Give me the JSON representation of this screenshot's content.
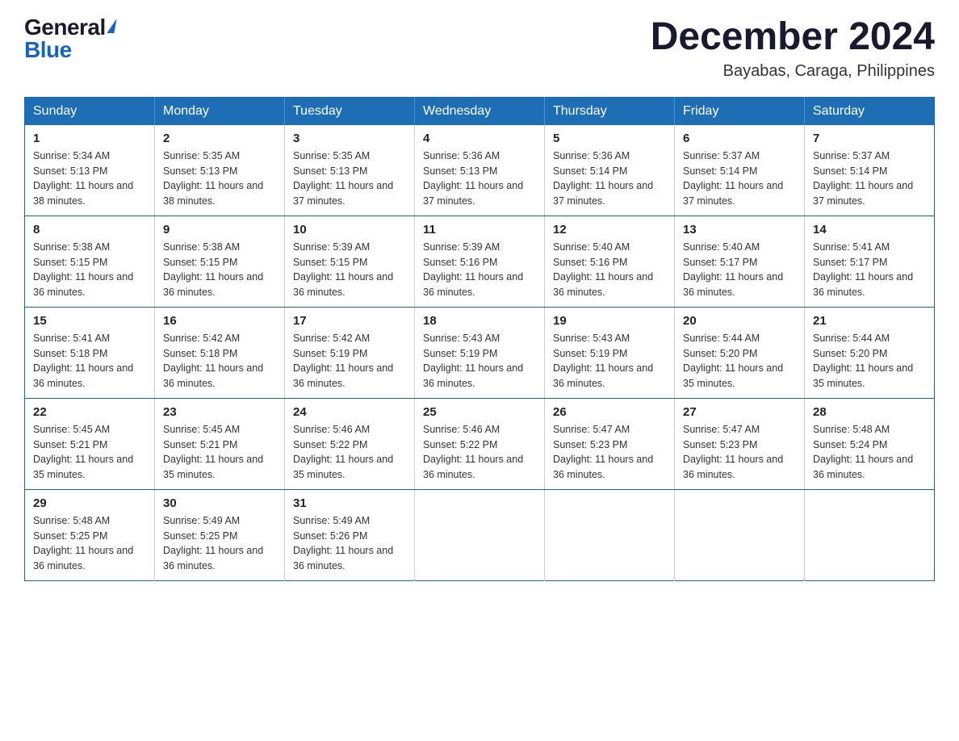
{
  "logo": {
    "general": "General",
    "blue": "Blue"
  },
  "header": {
    "month": "December 2024",
    "location": "Bayabas, Caraga, Philippines"
  },
  "days_of_week": [
    "Sunday",
    "Monday",
    "Tuesday",
    "Wednesday",
    "Thursday",
    "Friday",
    "Saturday"
  ],
  "weeks": [
    [
      {
        "day": "1",
        "sunrise": "5:34 AM",
        "sunset": "5:13 PM",
        "daylight": "11 hours and 38 minutes."
      },
      {
        "day": "2",
        "sunrise": "5:35 AM",
        "sunset": "5:13 PM",
        "daylight": "11 hours and 38 minutes."
      },
      {
        "day": "3",
        "sunrise": "5:35 AM",
        "sunset": "5:13 PM",
        "daylight": "11 hours and 37 minutes."
      },
      {
        "day": "4",
        "sunrise": "5:36 AM",
        "sunset": "5:13 PM",
        "daylight": "11 hours and 37 minutes."
      },
      {
        "day": "5",
        "sunrise": "5:36 AM",
        "sunset": "5:14 PM",
        "daylight": "11 hours and 37 minutes."
      },
      {
        "day": "6",
        "sunrise": "5:37 AM",
        "sunset": "5:14 PM",
        "daylight": "11 hours and 37 minutes."
      },
      {
        "day": "7",
        "sunrise": "5:37 AM",
        "sunset": "5:14 PM",
        "daylight": "11 hours and 37 minutes."
      }
    ],
    [
      {
        "day": "8",
        "sunrise": "5:38 AM",
        "sunset": "5:15 PM",
        "daylight": "11 hours and 36 minutes."
      },
      {
        "day": "9",
        "sunrise": "5:38 AM",
        "sunset": "5:15 PM",
        "daylight": "11 hours and 36 minutes."
      },
      {
        "day": "10",
        "sunrise": "5:39 AM",
        "sunset": "5:15 PM",
        "daylight": "11 hours and 36 minutes."
      },
      {
        "day": "11",
        "sunrise": "5:39 AM",
        "sunset": "5:16 PM",
        "daylight": "11 hours and 36 minutes."
      },
      {
        "day": "12",
        "sunrise": "5:40 AM",
        "sunset": "5:16 PM",
        "daylight": "11 hours and 36 minutes."
      },
      {
        "day": "13",
        "sunrise": "5:40 AM",
        "sunset": "5:17 PM",
        "daylight": "11 hours and 36 minutes."
      },
      {
        "day": "14",
        "sunrise": "5:41 AM",
        "sunset": "5:17 PM",
        "daylight": "11 hours and 36 minutes."
      }
    ],
    [
      {
        "day": "15",
        "sunrise": "5:41 AM",
        "sunset": "5:18 PM",
        "daylight": "11 hours and 36 minutes."
      },
      {
        "day": "16",
        "sunrise": "5:42 AM",
        "sunset": "5:18 PM",
        "daylight": "11 hours and 36 minutes."
      },
      {
        "day": "17",
        "sunrise": "5:42 AM",
        "sunset": "5:19 PM",
        "daylight": "11 hours and 36 minutes."
      },
      {
        "day": "18",
        "sunrise": "5:43 AM",
        "sunset": "5:19 PM",
        "daylight": "11 hours and 36 minutes."
      },
      {
        "day": "19",
        "sunrise": "5:43 AM",
        "sunset": "5:19 PM",
        "daylight": "11 hours and 36 minutes."
      },
      {
        "day": "20",
        "sunrise": "5:44 AM",
        "sunset": "5:20 PM",
        "daylight": "11 hours and 35 minutes."
      },
      {
        "day": "21",
        "sunrise": "5:44 AM",
        "sunset": "5:20 PM",
        "daylight": "11 hours and 35 minutes."
      }
    ],
    [
      {
        "day": "22",
        "sunrise": "5:45 AM",
        "sunset": "5:21 PM",
        "daylight": "11 hours and 35 minutes."
      },
      {
        "day": "23",
        "sunrise": "5:45 AM",
        "sunset": "5:21 PM",
        "daylight": "11 hours and 35 minutes."
      },
      {
        "day": "24",
        "sunrise": "5:46 AM",
        "sunset": "5:22 PM",
        "daylight": "11 hours and 35 minutes."
      },
      {
        "day": "25",
        "sunrise": "5:46 AM",
        "sunset": "5:22 PM",
        "daylight": "11 hours and 36 minutes."
      },
      {
        "day": "26",
        "sunrise": "5:47 AM",
        "sunset": "5:23 PM",
        "daylight": "11 hours and 36 minutes."
      },
      {
        "day": "27",
        "sunrise": "5:47 AM",
        "sunset": "5:23 PM",
        "daylight": "11 hours and 36 minutes."
      },
      {
        "day": "28",
        "sunrise": "5:48 AM",
        "sunset": "5:24 PM",
        "daylight": "11 hours and 36 minutes."
      }
    ],
    [
      {
        "day": "29",
        "sunrise": "5:48 AM",
        "sunset": "5:25 PM",
        "daylight": "11 hours and 36 minutes."
      },
      {
        "day": "30",
        "sunrise": "5:49 AM",
        "sunset": "5:25 PM",
        "daylight": "11 hours and 36 minutes."
      },
      {
        "day": "31",
        "sunrise": "5:49 AM",
        "sunset": "5:26 PM",
        "daylight": "11 hours and 36 minutes."
      },
      null,
      null,
      null,
      null
    ]
  ],
  "labels": {
    "sunrise_prefix": "Sunrise: ",
    "sunset_prefix": "Sunset: ",
    "daylight_prefix": "Daylight: "
  }
}
